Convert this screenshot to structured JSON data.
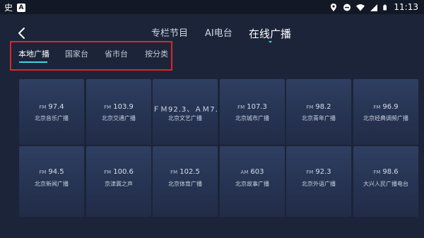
{
  "status_bar": {
    "app_glyph": "史",
    "app_badge": "A",
    "time": "11:13",
    "icons": [
      "location-icon",
      "dnd-icon",
      "wifi-icon",
      "signal-icon",
      "battery-icon"
    ]
  },
  "nav": {
    "back_icon": "chevron-left-icon",
    "tabs": [
      {
        "label": "专栏节目",
        "active": false
      },
      {
        "label": "AI电台",
        "active": false
      },
      {
        "label": "在线广播",
        "active": true
      }
    ]
  },
  "sub_tabs": [
    {
      "label": "本地广播",
      "active": true
    },
    {
      "label": "国家台",
      "active": false
    },
    {
      "label": "省市台",
      "active": false
    },
    {
      "label": "按分类",
      "active": false
    }
  ],
  "stations": [
    {
      "band": "FM",
      "freq": "97.4",
      "name": "北京音乐广播"
    },
    {
      "band": "FM",
      "freq": "103.9",
      "name": "北京交通广播"
    },
    {
      "band": "",
      "freq": "ＦＭ92.3、ＡＭ7…",
      "name": "北京文艺广播"
    },
    {
      "band": "FM",
      "freq": "107.3",
      "name": "北京城市广播"
    },
    {
      "band": "FM",
      "freq": "98.2",
      "name": "北京青年广播"
    },
    {
      "band": "FM",
      "freq": "96.9",
      "name": "北京经典调频广播"
    },
    {
      "band": "FM",
      "freq": "94.5",
      "name": "北京新闻广播"
    },
    {
      "band": "FM",
      "freq": "100.6",
      "name": "京津冀之声"
    },
    {
      "band": "FM",
      "freq": "102.5",
      "name": "北京体育广播"
    },
    {
      "band": "AM",
      "freq": "603",
      "name": "北京故事广播"
    },
    {
      "band": "FM",
      "freq": "92.3",
      "name": "北京外语广播"
    },
    {
      "band": "FM",
      "freq": "98.6",
      "name": "大兴人民广播电台"
    }
  ],
  "colors": {
    "background": "#1b2438",
    "card": "#2b3a5a",
    "accent": "#3fd3e0",
    "highlight_box": "#e0232e"
  }
}
